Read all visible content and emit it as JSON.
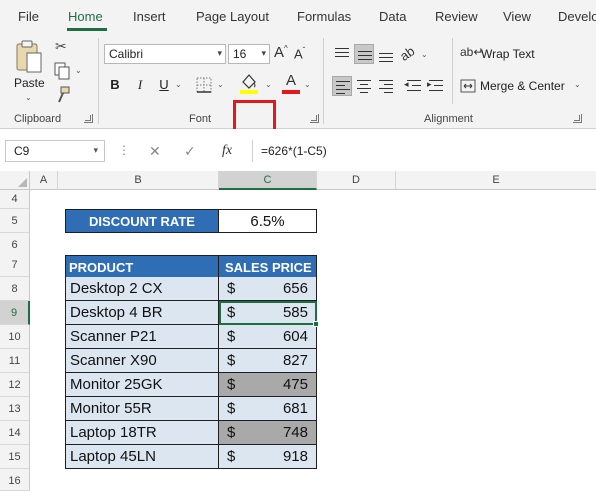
{
  "ribbon": {
    "tabs": [
      "File",
      "Home",
      "Insert",
      "Page Layout",
      "Formulas",
      "Data",
      "Review",
      "View",
      "Develo"
    ],
    "active_tab": "Home",
    "clipboard": {
      "paste_label": "Paste",
      "group_label": "Clipboard"
    },
    "font": {
      "name": "Calibri",
      "size": "16",
      "group_label": "Font",
      "bold": "B",
      "italic": "I",
      "underline": "U",
      "fill_color": "#ffff00",
      "font_color": "#e0191d"
    },
    "alignment": {
      "wrap_text": "Wrap Text",
      "merge_center": "Merge & Center",
      "group_label": "Alignment"
    }
  },
  "formula_bar": {
    "name_box": "C9",
    "formula": "=626*(1-C5)"
  },
  "grid": {
    "columns": [
      "A",
      "B",
      "C",
      "D",
      "E"
    ],
    "selected_column": "C",
    "rows": [
      "4",
      "5",
      "6",
      "7",
      "8",
      "9",
      "10",
      "11",
      "12",
      "13",
      "14",
      "15",
      "16"
    ],
    "selected_row": "9"
  },
  "sheet": {
    "discount_label": "DISCOUNT RATE",
    "discount_value": "6.5%",
    "header_product": "PRODUCT",
    "header_price": "SALES PRICE",
    "items": [
      {
        "product": "Desktop 2 CX",
        "currency": "$",
        "price": "656"
      },
      {
        "product": "Desktop 4 BR",
        "currency": "$",
        "price": "585"
      },
      {
        "product": "Scanner P21",
        "currency": "$",
        "price": "604"
      },
      {
        "product": "Scanner X90",
        "currency": "$",
        "price": "827"
      },
      {
        "product": "Monitor 25GK",
        "currency": "$",
        "price": "475"
      },
      {
        "product": "Monitor 55R",
        "currency": "$",
        "price": "681"
      },
      {
        "product": "Laptop 18TR",
        "currency": "$",
        "price": "748"
      },
      {
        "product": "Laptop 45LN",
        "currency": "$",
        "price": "918"
      }
    ]
  }
}
